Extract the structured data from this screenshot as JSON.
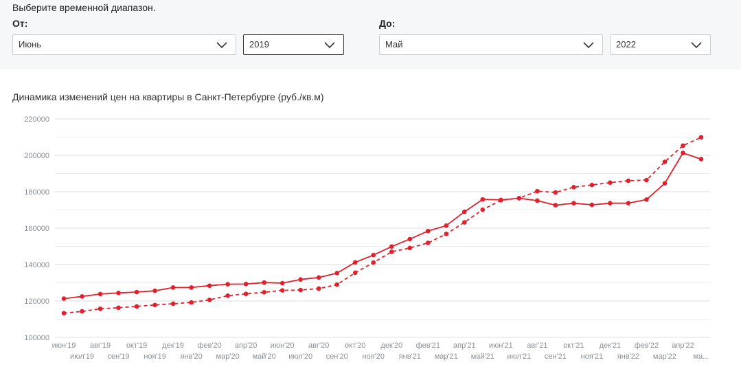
{
  "filters": {
    "prompt": "Выберите временной диапазон.",
    "from_label": "От:",
    "to_label": "До:",
    "from_month": "Июнь",
    "from_year": "2019",
    "to_month": "Май",
    "to_year": "2022"
  },
  "chart_data": {
    "type": "line",
    "title": "Динамика изменений цен на квартиры в Санкт-Петербурге (руб./кв.м)",
    "categories": [
      "июн'19",
      "июл'19",
      "авг'19",
      "сен'19",
      "окт'19",
      "ноя'19",
      "дек'19",
      "янв'20",
      "фев'20",
      "мар'20",
      "апр'20",
      "май'20",
      "июн'20",
      "июл'20",
      "авг'20",
      "сен'20",
      "окт'20",
      "ноя'20",
      "дек'20",
      "янв'21",
      "фев'21",
      "мар'21",
      "апр'21",
      "май'21",
      "июн'21",
      "июл'21",
      "авг'21",
      "сен'21",
      "окт'21",
      "ноя'21",
      "дек'21",
      "янв'22",
      "фев'22",
      "мар'22",
      "апр'22",
      "ма..."
    ],
    "ylim": [
      100000,
      220000
    ],
    "yticks": [
      100000,
      120000,
      140000,
      160000,
      180000,
      200000,
      220000
    ],
    "grid": true,
    "colors": {
      "line": "#e0202c"
    },
    "series": [
      {
        "style": "solid",
        "values": [
          121300,
          122500,
          123800,
          124400,
          124900,
          125600,
          127400,
          127400,
          128400,
          129200,
          129300,
          130100,
          129800,
          131800,
          132900,
          135300,
          141200,
          145200,
          149900,
          154000,
          158400,
          161400,
          169000,
          175800,
          175500,
          176400,
          175100,
          172600,
          173700,
          172800,
          173700,
          173700,
          175700,
          184600,
          201300,
          197900
        ]
      },
      {
        "style": "dashed",
        "values": [
          113300,
          114300,
          115700,
          116300,
          117000,
          117800,
          118500,
          119200,
          120600,
          122900,
          123900,
          124800,
          125800,
          126000,
          126800,
          129000,
          135500,
          141100,
          147000,
          149100,
          151900,
          156800,
          163200,
          170100,
          175300,
          176500,
          180300,
          179600,
          182500,
          183700,
          185000,
          186000,
          186400,
          196400,
          205300,
          209900
        ]
      }
    ]
  }
}
